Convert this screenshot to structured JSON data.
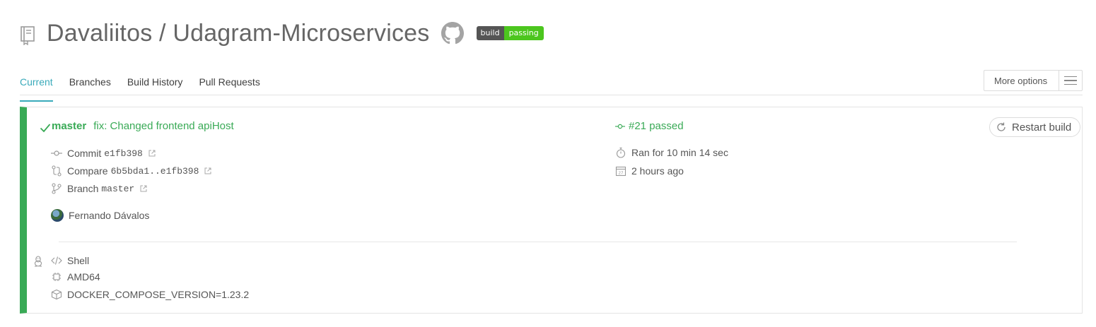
{
  "header": {
    "title": "Davaliitos / Udagram-Microservices",
    "badge_left": "build",
    "badge_right": "passing",
    "icons": [
      "repo-icon",
      "github-icon"
    ]
  },
  "tabs": [
    {
      "label": "Current",
      "active": true
    },
    {
      "label": "Branches",
      "active": false
    },
    {
      "label": "Build History",
      "active": false
    },
    {
      "label": "Pull Requests",
      "active": false
    }
  ],
  "more_options": {
    "label": "More options",
    "icon": "hamburger-menu-icon"
  },
  "build": {
    "status_color": "#39aa56",
    "branch": "master",
    "commit_message": "fix: Changed frontend apiHost",
    "commit_prefix": "Commit",
    "commit_sha": "e1fb398",
    "compare_prefix": "Compare",
    "compare_range": "6b5bda1..e1fb398",
    "branch_prefix": "Branch",
    "branch_value": "master",
    "author": "Fernando Dávalos",
    "build_number": "#21 passed",
    "duration": "Ran for 10 min 14 sec",
    "finished": "2 hours ago",
    "restart_label": "Restart build"
  },
  "job": {
    "language": "Shell",
    "arch": "AMD64",
    "env": "DOCKER_COMPOSE_VERSION=1.23.2",
    "os_icon": "linux-icon"
  },
  "colors": {
    "accent": "#39aaba",
    "success": "#39aa56",
    "badge_green": "#4cc61e"
  }
}
